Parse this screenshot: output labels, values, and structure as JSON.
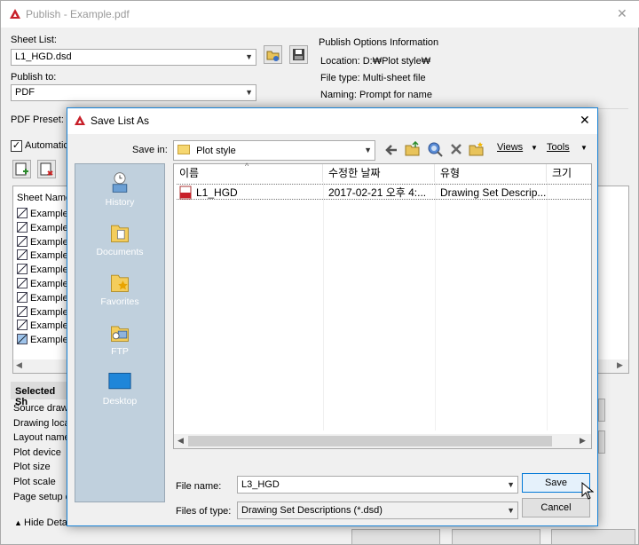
{
  "publish": {
    "title": "Publish - Example.pdf",
    "close_glyph": "✕",
    "sheet_list_label": "Sheet List:",
    "sheet_list_value": "L1_HGD.dsd",
    "publish_to_label": "Publish to:",
    "publish_to_value": "PDF",
    "pdf_preset_label": "PDF Preset:",
    "automatic_label": "Automatica",
    "info": {
      "header": "Publish Options Information",
      "location": "Location: D:₩Plot style₩",
      "file_type": "File type: Multi-sheet file",
      "naming": "Naming: Prompt for name"
    },
    "sheet_name_header": "Sheet Name",
    "sheets": [
      "Example.",
      "Example.",
      "Example.",
      "Example.",
      "Example.",
      "Example.",
      "Example.",
      "Example.",
      "Example.",
      "Example."
    ],
    "selected_section": "Selected Sh",
    "details": [
      "Source drawin",
      "Drawing locat",
      "Layout name",
      "Plot device",
      "Plot size",
      "Plot scale",
      "Page setup d"
    ],
    "hide_details": "Hide Detail"
  },
  "dialog": {
    "title": "Save List As",
    "close_glyph": "✕",
    "save_in_label": "Save in:",
    "save_in_value": "Plot style",
    "views_label": "Views",
    "tools_label": "Tools",
    "places": [
      {
        "label": "History",
        "icon": "history-icon"
      },
      {
        "label": "Documents",
        "icon": "documents-folder-icon"
      },
      {
        "label": "Favorites",
        "icon": "favorites-folder-icon"
      },
      {
        "label": "FTP",
        "icon": "ftp-icon"
      },
      {
        "label": "Desktop",
        "icon": "desktop-icon"
      }
    ],
    "columns": [
      "이름",
      "수정한 날짜",
      "유형",
      "크기"
    ],
    "files": [
      {
        "name": "L1_HGD",
        "modified": "2017-02-21 오후 4:...",
        "type": "Drawing Set Descrip...",
        "size": ""
      }
    ],
    "file_name_label": "File name:",
    "file_name_value": "L3_HGD",
    "files_of_type_label": "Files of type:",
    "files_of_type_value": "Drawing Set Descriptions (*.dsd)",
    "save_button": "Save",
    "cancel_button": "Cancel"
  },
  "colors": {
    "accent_border": "#1883d7",
    "places_bg": "#c0d0dd",
    "logo_red": "#c8202a"
  }
}
